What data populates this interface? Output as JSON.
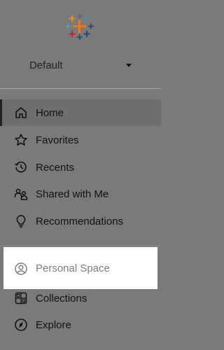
{
  "app": {
    "logo_icon": "tableau-logo-icon"
  },
  "site": {
    "label": "Default"
  },
  "nav": {
    "items": [
      {
        "label": "Home",
        "icon": "home-icon",
        "active": true
      },
      {
        "label": "Favorites",
        "icon": "star-icon"
      },
      {
        "label": "Recents",
        "icon": "history-icon"
      },
      {
        "label": "Shared with Me",
        "icon": "shared-users-icon"
      },
      {
        "label": "Recommendations",
        "icon": "lightbulb-icon"
      },
      {
        "label": "Personal Space",
        "icon": "person-circle-icon",
        "highlighted": true
      },
      {
        "label": "Collections",
        "icon": "collections-icon"
      },
      {
        "label": "Explore",
        "icon": "compass-icon"
      }
    ]
  },
  "colors": {
    "background": "#7a7a7a",
    "highlight": "#ffffff",
    "active_bar": "#222222"
  }
}
